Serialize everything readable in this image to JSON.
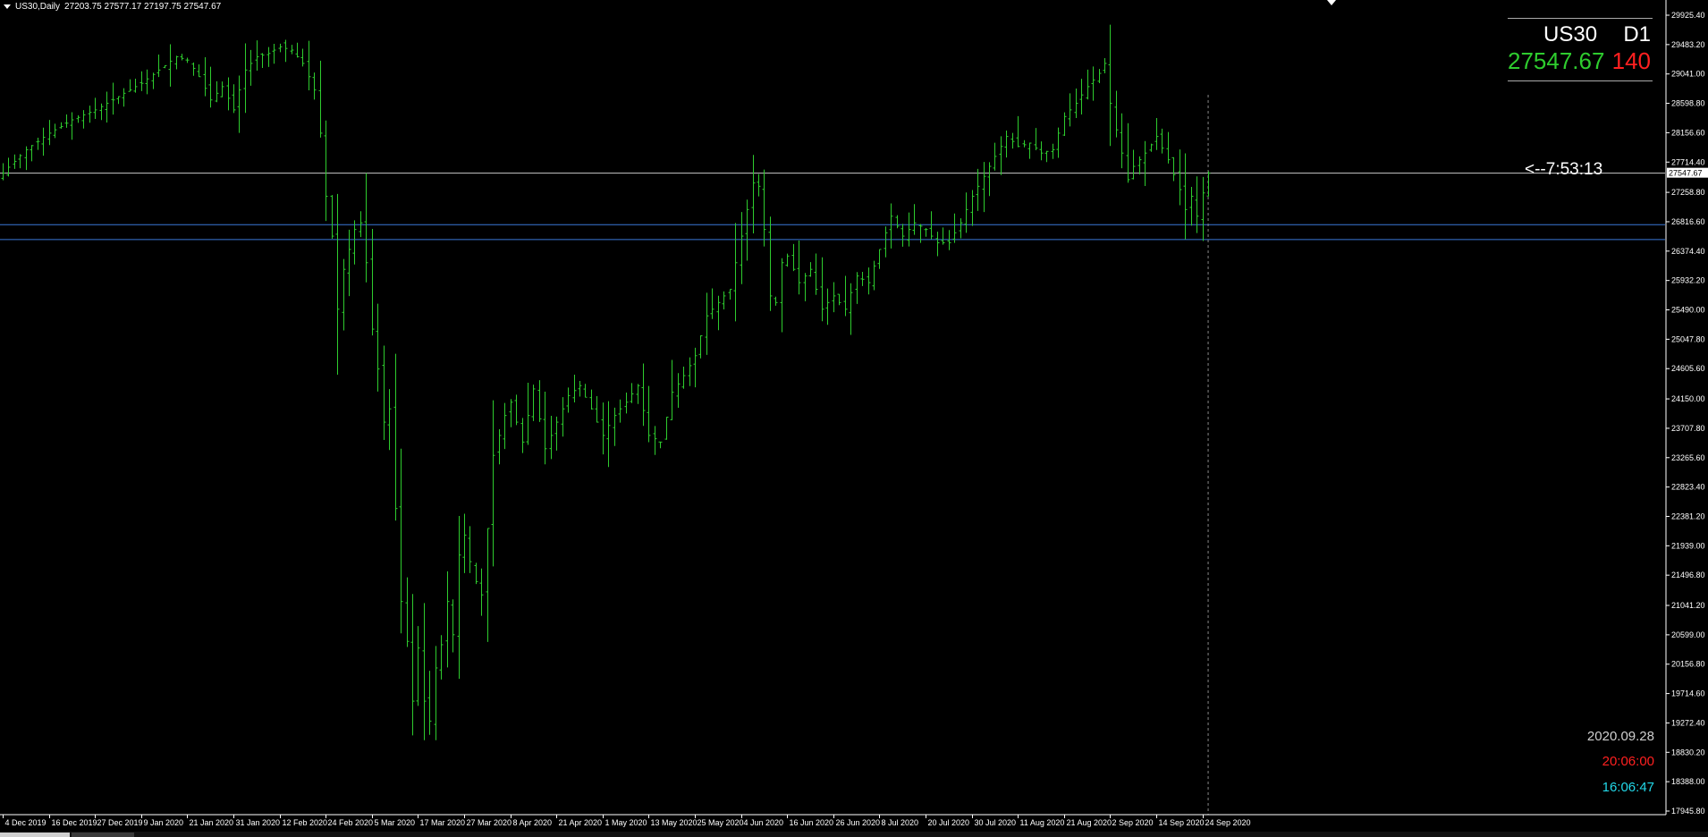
{
  "window": {
    "symbol_title": "US30,Daily",
    "ohlc_text": "27203.75 27577.17 27197.75 27547.67"
  },
  "panel": {
    "symbol": "US30",
    "timeframe": "D1",
    "price": "27547.67",
    "spread": "140",
    "timer": "<--7:53:13"
  },
  "clock": {
    "date": "2020.09.28",
    "server_time": "20:06:00",
    "local_time": "16:06:47"
  },
  "colors": {
    "background": "#000000",
    "bar": "#2ecc2e",
    "bid_line": "#c8c8c8",
    "level_line": "#3a78d8",
    "axis_text": "#ffffff",
    "spread": "#ff2020",
    "local_time": "#22d8e8"
  },
  "chart_data": {
    "type": "ohlc",
    "current_price": 27547.67,
    "current_price_label": "27547.67",
    "ylim": [
      17945.8,
      30150
    ],
    "yticks": [
      "29925.40",
      "29483.20",
      "29041.00",
      "28598.80",
      "28156.60",
      "27714.40",
      "27258.80",
      "26816.60",
      "26374.40",
      "25932.20",
      "25490.00",
      "25047.80",
      "24605.60",
      "24150.00",
      "23707.80",
      "23265.60",
      "22823.40",
      "22381.20",
      "21939.00",
      "21496.80",
      "21041.20",
      "20599.00",
      "20156.80",
      "19714.60",
      "19272.40",
      "18830.20",
      "18388.00",
      "17945.80"
    ],
    "horizontal_levels": [
      26773.0,
      26549.0
    ],
    "xticks": [
      {
        "bar": 0,
        "label": "4 Dec 2019"
      },
      {
        "bar": 8,
        "label": "16 Dec 2019"
      },
      {
        "bar": 16,
        "label": "27 Dec 2019"
      },
      {
        "bar": 24,
        "label": "9 Jan 2020"
      },
      {
        "bar": 32,
        "label": "21 Jan 2020"
      },
      {
        "bar": 40,
        "label": "31 Jan 2020"
      },
      {
        "bar": 48,
        "label": "12 Feb 2020"
      },
      {
        "bar": 56,
        "label": "24 Feb 2020"
      },
      {
        "bar": 64,
        "label": "5 Mar 2020"
      },
      {
        "bar": 72,
        "label": "17 Mar 2020"
      },
      {
        "bar": 80,
        "label": "27 Mar 2020"
      },
      {
        "bar": 88,
        "label": "8 Apr 2020"
      },
      {
        "bar": 96,
        "label": "21 Apr 2020"
      },
      {
        "bar": 104,
        "label": "1 May 2020"
      },
      {
        "bar": 112,
        "label": "13 May 2020"
      },
      {
        "bar": 120,
        "label": "25 May 2020"
      },
      {
        "bar": 128,
        "label": "4 Jun 2020"
      },
      {
        "bar": 136,
        "label": "16 Jun 2020"
      },
      {
        "bar": 144,
        "label": "26 Jun 2020"
      },
      {
        "bar": 152,
        "label": "8 Jul 2020"
      },
      {
        "bar": 160,
        "label": "20 Jul 2020"
      },
      {
        "bar": 168,
        "label": "30 Jul 2020"
      },
      {
        "bar": 176,
        "label": "11 Aug 2020"
      },
      {
        "bar": 184,
        "label": "21 Aug 2020"
      },
      {
        "bar": 192,
        "label": "2 Sep 2020"
      },
      {
        "bar": 200,
        "label": "14 Sep 2020"
      },
      {
        "bar": 208,
        "label": "24 Sep 2020"
      }
    ],
    "anchors": [
      [
        0,
        27550
      ],
      [
        4,
        27900
      ],
      [
        8,
        28150
      ],
      [
        12,
        28350
      ],
      [
        16,
        28500
      ],
      [
        20,
        28700
      ],
      [
        24,
        28900
      ],
      [
        27,
        29100
      ],
      [
        30,
        29300
      ],
      [
        32,
        29250
      ],
      [
        34,
        29000
      ],
      [
        36,
        28650
      ],
      [
        38,
        28850
      ],
      [
        40,
        28500
      ],
      [
        42,
        29100
      ],
      [
        44,
        29300
      ],
      [
        46,
        29350
      ],
      [
        48,
        29450
      ],
      [
        50,
        29400
      ],
      [
        52,
        29200
      ],
      [
        54,
        28800
      ],
      [
        55,
        28150
      ],
      [
        56,
        27200
      ],
      [
        57,
        26600
      ],
      [
        58,
        25500
      ],
      [
        59,
        26100
      ],
      [
        60,
        26400
      ],
      [
        61,
        26700
      ],
      [
        62,
        26800
      ],
      [
        63,
        26200
      ],
      [
        64,
        25200
      ],
      [
        65,
        24600
      ],
      [
        66,
        23800
      ],
      [
        67,
        24000
      ],
      [
        68,
        22500
      ],
      [
        69,
        21100
      ],
      [
        70,
        20500
      ],
      [
        71,
        19600
      ],
      [
        72,
        20400
      ],
      [
        73,
        19600
      ],
      [
        74,
        19300
      ],
      [
        75,
        20100
      ],
      [
        76,
        20450
      ],
      [
        77,
        21100
      ],
      [
        78,
        20600
      ],
      [
        79,
        21800
      ],
      [
        80,
        22100
      ],
      [
        81,
        21700
      ],
      [
        82,
        21400
      ],
      [
        83,
        21200
      ],
      [
        84,
        22200
      ],
      [
        85,
        23300
      ],
      [
        86,
        23600
      ],
      [
        87,
        23900
      ],
      [
        88,
        24100
      ],
      [
        90,
        23500
      ],
      [
        92,
        24300
      ],
      [
        94,
        23400
      ],
      [
        96,
        23800
      ],
      [
        98,
        24200
      ],
      [
        100,
        24350
      ],
      [
        102,
        24000
      ],
      [
        104,
        23600
      ],
      [
        106,
        23900
      ],
      [
        108,
        24100
      ],
      [
        110,
        24350
      ],
      [
        112,
        23600
      ],
      [
        114,
        23500
      ],
      [
        116,
        24250
      ],
      [
        118,
        24500
      ],
      [
        120,
        24800
      ],
      [
        122,
        25400
      ],
      [
        124,
        25600
      ],
      [
        126,
        25800
      ],
      [
        127,
        26200
      ],
      [
        128,
        26600
      ],
      [
        129,
        27000
      ],
      [
        130,
        27400
      ],
      [
        131,
        27350
      ],
      [
        132,
        26700
      ],
      [
        133,
        25700
      ],
      [
        134,
        25600
      ],
      [
        135,
        26200
      ],
      [
        136,
        26300
      ],
      [
        138,
        25900
      ],
      [
        140,
        26100
      ],
      [
        142,
        25500
      ],
      [
        144,
        25700
      ],
      [
        146,
        25500
      ],
      [
        148,
        26000
      ],
      [
        150,
        25900
      ],
      [
        152,
        26400
      ],
      [
        154,
        26900
      ],
      [
        156,
        26600
      ],
      [
        158,
        26800
      ],
      [
        160,
        26700
      ],
      [
        162,
        26500
      ],
      [
        164,
        26500
      ],
      [
        166,
        26800
      ],
      [
        168,
        27200
      ],
      [
        170,
        27500
      ],
      [
        172,
        27800
      ],
      [
        174,
        28100
      ],
      [
        176,
        27950
      ],
      [
        178,
        28000
      ],
      [
        180,
        27850
      ],
      [
        182,
        27900
      ],
      [
        184,
        28400
      ],
      [
        186,
        28600
      ],
      [
        188,
        28850
      ],
      [
        190,
        29050
      ],
      [
        191,
        29200
      ],
      [
        192,
        28600
      ],
      [
        193,
        28200
      ],
      [
        194,
        27850
      ],
      [
        195,
        27450
      ],
      [
        196,
        27650
      ],
      [
        198,
        27850
      ],
      [
        200,
        28100
      ],
      [
        202,
        27750
      ],
      [
        204,
        27300
      ],
      [
        205,
        27000
      ],
      [
        206,
        27200
      ],
      [
        207,
        26900
      ],
      [
        208,
        27250
      ],
      [
        209,
        27547.67
      ]
    ],
    "last_bar": {
      "open": 27203.75,
      "high": 27577.17,
      "low": 27197.75,
      "close": 27547.67
    }
  }
}
